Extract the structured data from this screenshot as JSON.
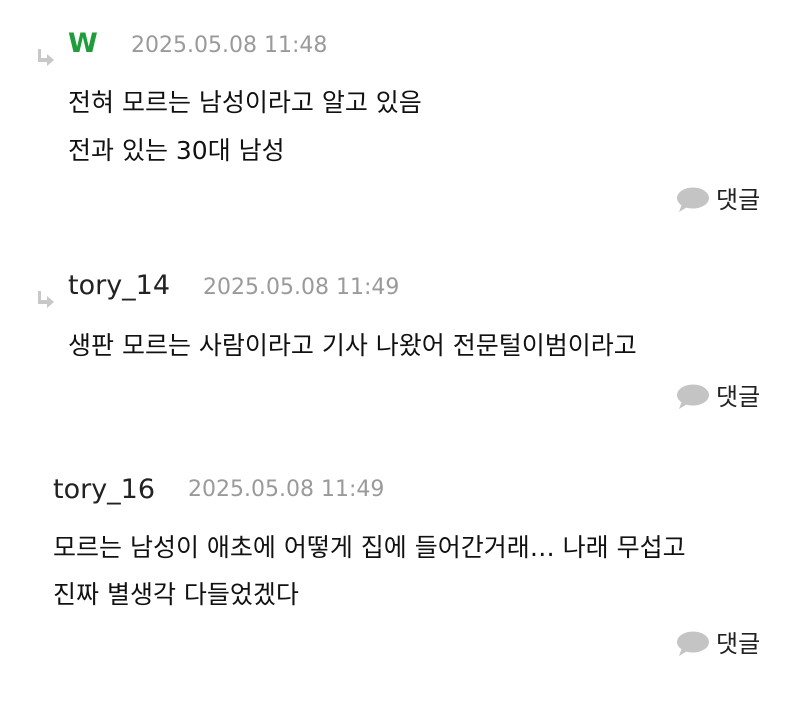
{
  "comments": [
    {
      "author": "W",
      "timestamp": "2025.05.08 11:48",
      "lines": [
        "전혀 모르는 남성이라고 알고 있음",
        "전과 있는 30대 남성"
      ],
      "reply_label": "댓글",
      "is_reply": true,
      "author_color": "#1f9d3a"
    },
    {
      "author": "tory_14",
      "timestamp": "2025.05.08 11:49",
      "lines": [
        "생판 모르는 사람이라고 기사 나왔어 전문털이범이라고"
      ],
      "reply_label": "댓글",
      "is_reply": true
    },
    {
      "author": "tory_16",
      "timestamp": "2025.05.08 11:49",
      "lines": [
        "모르는 남성이 애초에 어떻게 집에 들어간거래… 나래 무섭고",
        "진짜 별생각 다들었겠다"
      ],
      "reply_label": "댓글",
      "is_reply": false
    }
  ],
  "icons": {
    "reply_arrow": "reply-arrow-icon",
    "speech_bubble": "speech-bubble-icon"
  },
  "colors": {
    "bubble": "#c4c4c4",
    "arrow": "#c8c8c8",
    "timestamp": "#9a9a9a",
    "accent_author": "#1f9d3a"
  }
}
